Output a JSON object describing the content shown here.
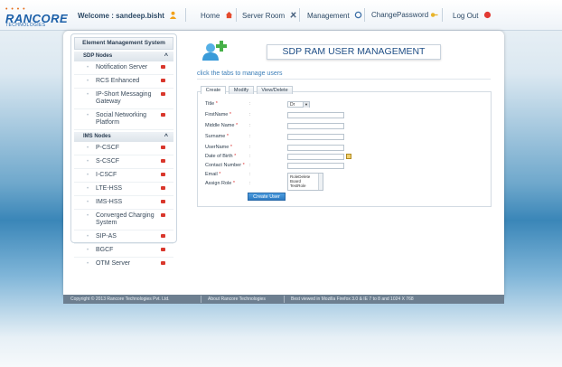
{
  "header": {
    "logo_word": "RANCORE",
    "logo_sub": "TECHNOLOGIES",
    "welcome": "Welcome : sandeep.bisht",
    "nav": [
      {
        "label": "Home"
      },
      {
        "label": "Server Room"
      },
      {
        "label": "Management"
      },
      {
        "label": "ChangePassword"
      },
      {
        "label": "Log Out"
      }
    ]
  },
  "sidebar": {
    "title": "Element Management System",
    "groups": [
      {
        "label": "SDP Nodes",
        "items": [
          {
            "label": "Notification Server"
          },
          {
            "label": "RCS Enhanced"
          },
          {
            "label": "IP-Short Messaging Gateway"
          },
          {
            "label": "Social Networking Platform"
          }
        ]
      },
      {
        "label": "IMS Nodes",
        "items": [
          {
            "label": "P-CSCF"
          },
          {
            "label": "S-CSCF"
          },
          {
            "label": "I-CSCF"
          },
          {
            "label": "LTE-HSS"
          },
          {
            "label": "IMS-HSS"
          },
          {
            "label": "Converged Charging System"
          },
          {
            "label": "SIP-AS"
          },
          {
            "label": "BGCF"
          },
          {
            "label": "OTM Server"
          }
        ]
      }
    ]
  },
  "main": {
    "title": "SDP RAM USER MANAGEMENT",
    "hint": "click the tabs to manage users",
    "tabs": [
      {
        "label": "Create"
      },
      {
        "label": "Modify"
      },
      {
        "label": "View/Delete"
      }
    ],
    "form": {
      "fields": [
        {
          "label": "Title"
        },
        {
          "label": "FirstName"
        },
        {
          "label": "Middle Name"
        },
        {
          "label": "Surname"
        },
        {
          "label": "UserName"
        },
        {
          "label": "Date of Birth"
        },
        {
          "label": "Contact Number"
        },
        {
          "label": "Email"
        },
        {
          "label": "Assign Role"
        }
      ],
      "title_value": "Dr",
      "roles": [
        "RoleDelete",
        "Board",
        "TestRole"
      ],
      "submit_label": "Create User"
    }
  },
  "footer": {
    "copyright": "Copyright © 2013 Rancore Technologies Pvt. Ltd.",
    "about": "About Rancore Technologies",
    "browser_note": "Best viewed in Mozilla Firefox 3.0 & IE 7 to 8 and 1024 X 768"
  },
  "colors": {
    "accent": "#1e4e86",
    "link": "#3d7fb8",
    "button": "#2d7ac2",
    "footer": "#6d7f90"
  }
}
